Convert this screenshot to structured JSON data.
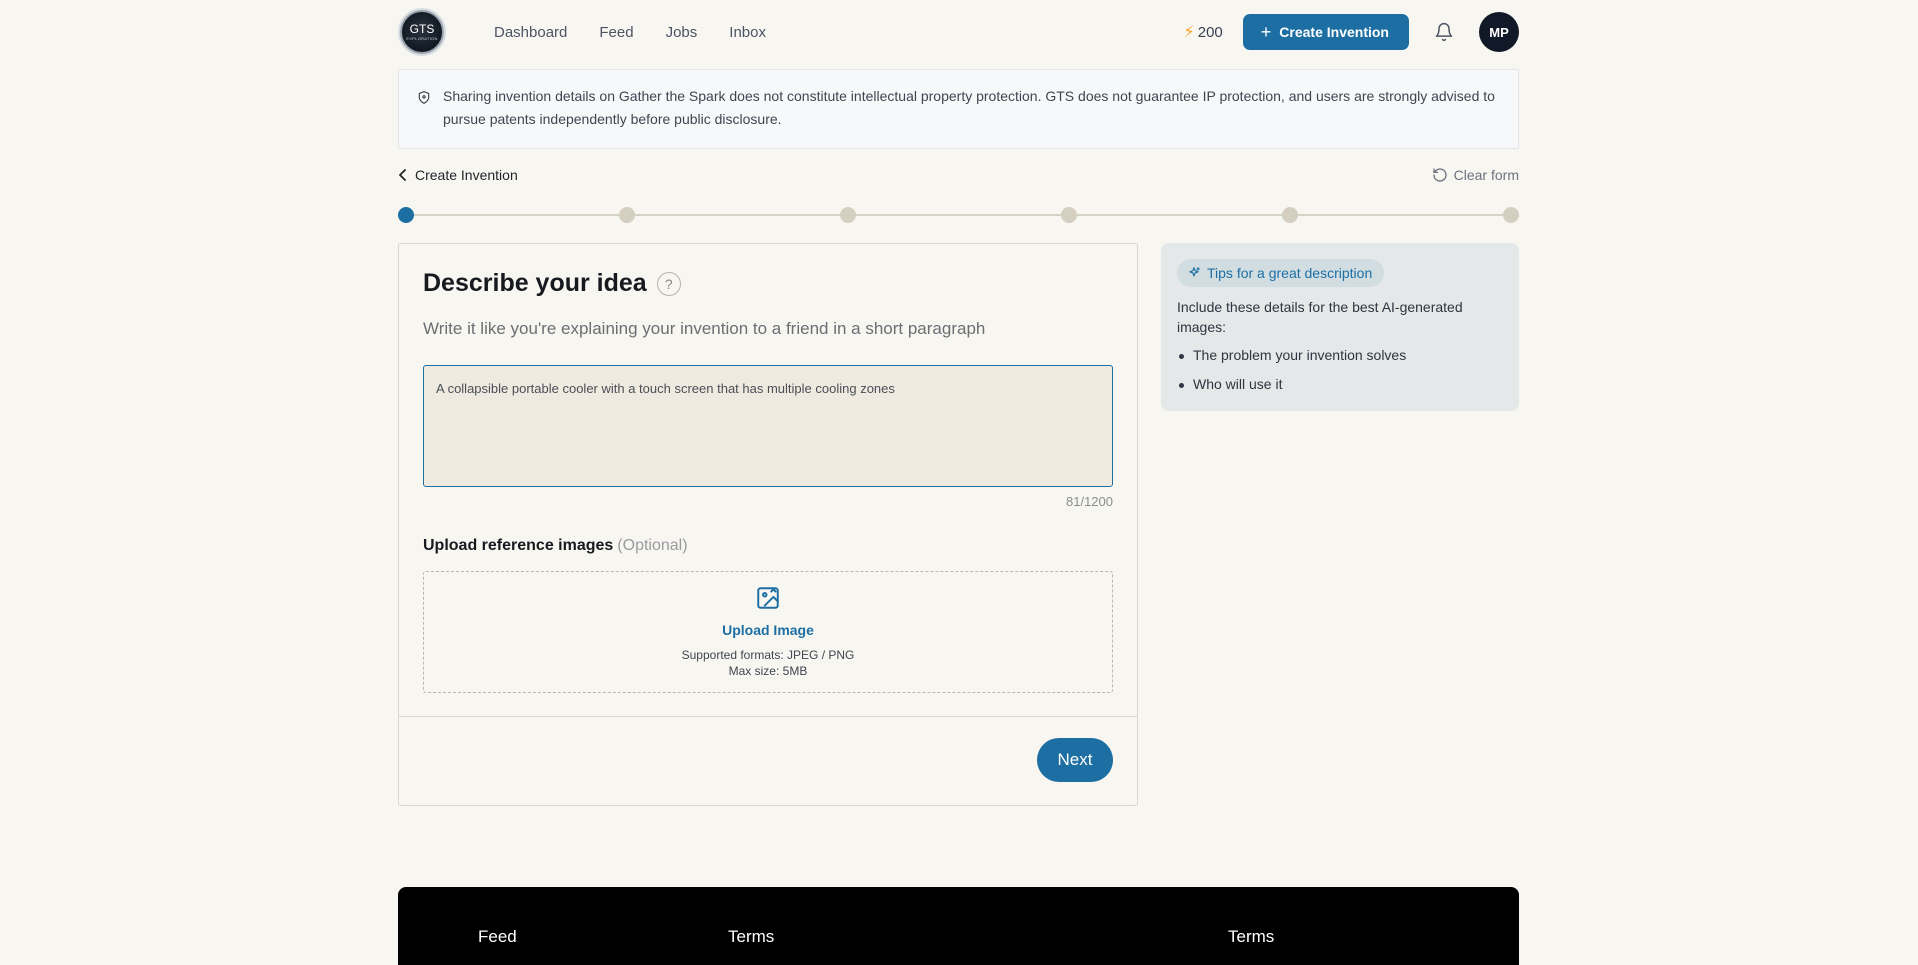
{
  "header": {
    "logo_text": "GTS",
    "logo_subtext": "EXPLORATION",
    "nav": [
      "Dashboard",
      "Feed",
      "Jobs",
      "Inbox"
    ],
    "credits": "200",
    "create_label": "Create Invention",
    "avatar_initials": "MP"
  },
  "disclaimer": {
    "text": "Sharing invention details on Gather the Spark does not constitute intellectual property protection. GTS does not guarantee IP protection, and users are strongly advised to pursue patents independently before public disclosure."
  },
  "subheader": {
    "back_label": "Create Invention",
    "clear_label": "Clear form"
  },
  "stepper": {
    "total_steps": 6,
    "current_step": 1
  },
  "form": {
    "title": "Describe your idea",
    "help_glyph": "?",
    "subtitle": "Write it like you're explaining your invention to a friend in a short paragraph",
    "description_value": "A collapsible portable cooler with a touch screen that has multiple cooling zones",
    "counter": "81/1200",
    "upload_label": "Upload reference images",
    "upload_optional": "(Optional)",
    "upload_button": "Upload Image",
    "upload_formats": "Supported formats: JPEG / PNG",
    "upload_max": "Max size: 5MB",
    "next_label": "Next"
  },
  "tips": {
    "badge": "Tips for a great description",
    "intro": "Include these details for the best AI-generated images:",
    "items": [
      "The problem your invention solves",
      "Who will use it"
    ]
  },
  "footer": {
    "columns": [
      "Feed",
      "Terms",
      "Terms"
    ]
  },
  "colors": {
    "accent": "#1d6fa3",
    "background": "#f8f6f1",
    "textarea_bg": "#efeae0",
    "tips_bg": "#e4e8e8",
    "footer_bg": "#000000"
  }
}
